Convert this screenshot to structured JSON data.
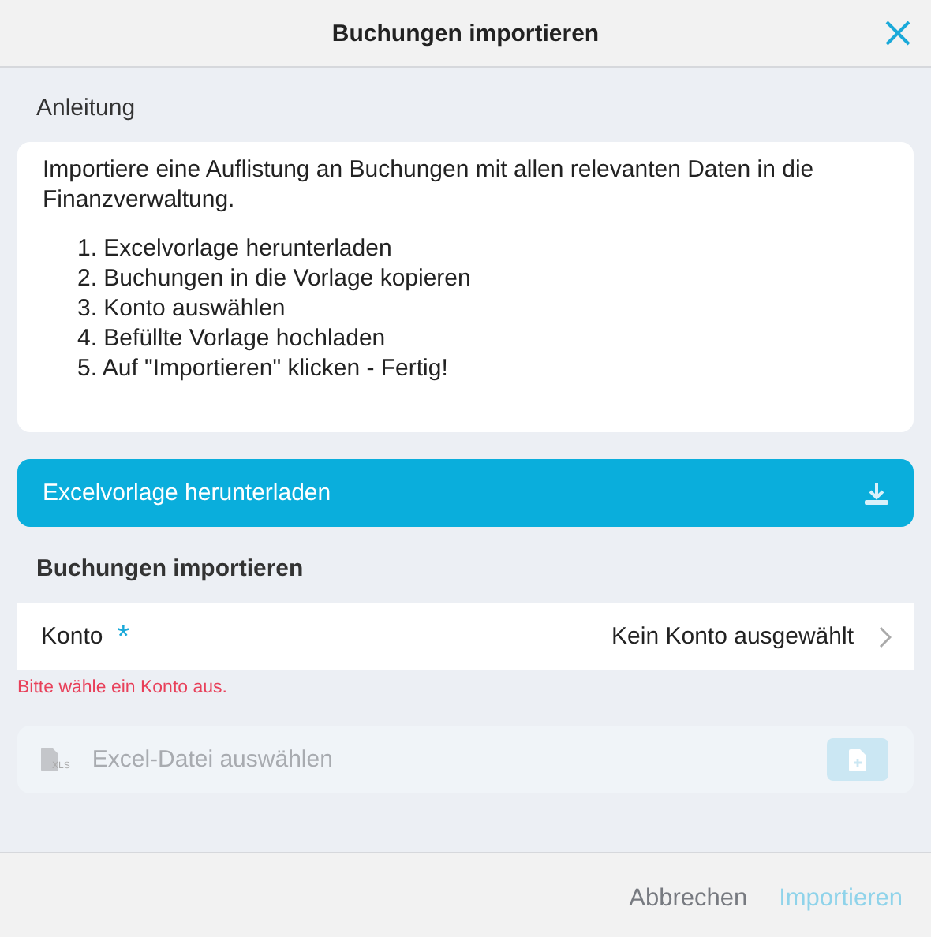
{
  "dialog": {
    "title": "Buchungen importieren"
  },
  "instructions": {
    "heading": "Anleitung",
    "intro": "Importiere eine Auflistung an Buchungen mit allen relevanten Daten in die Finanzverwaltung.",
    "steps": [
      "1. Excelvorlage herunterladen",
      "2. Buchungen in die Vorlage kopieren",
      "3. Konto auswählen",
      "4. Befüllte Vorlage hochladen",
      "5. Auf \"Importieren\" klicken - Fertig!"
    ]
  },
  "download_button": {
    "label": "Excelvorlage herunterladen"
  },
  "import_section": {
    "heading": "Buchungen importieren",
    "account": {
      "label": "Konto",
      "required_mark": "*",
      "value": "Kein Konto ausgewählt",
      "error": "Bitte wähle ein Konto aus."
    },
    "file": {
      "icon_label": "XLS",
      "placeholder": "Excel-Datei auswählen",
      "disabled": true
    }
  },
  "footer": {
    "buttons": [
      {
        "label": "Abbrechen",
        "kind": "secondary",
        "disabled": false
      },
      {
        "label": "Importieren",
        "kind": "primary",
        "disabled": true
      }
    ]
  }
}
